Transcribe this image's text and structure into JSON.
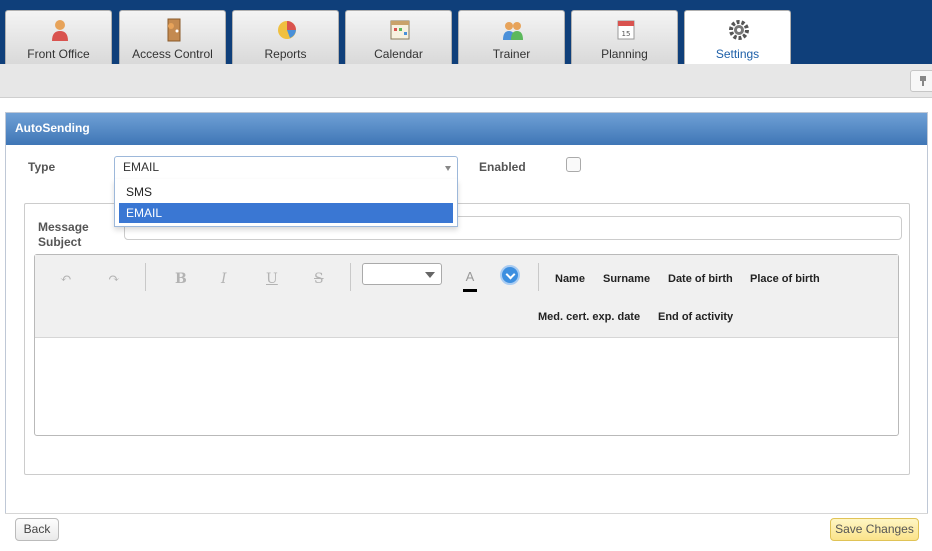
{
  "tabs": [
    {
      "label": "Front Office",
      "icon": "front-office-icon"
    },
    {
      "label": "Access Control",
      "icon": "access-control-icon"
    },
    {
      "label": "Reports",
      "icon": "reports-pie-icon"
    },
    {
      "label": "Calendar",
      "icon": "calendar-icon"
    },
    {
      "label": "Trainer",
      "icon": "trainer-icon"
    },
    {
      "label": "Planning",
      "icon": "planning-icon"
    },
    {
      "label": "Settings",
      "icon": "settings-gear-icon",
      "active": true
    }
  ],
  "panel": {
    "title": "AutoSending"
  },
  "form": {
    "type_label": "Type",
    "type_value": "EMAIL",
    "type_options": [
      "SMS",
      "EMAIL"
    ],
    "type_selected_option": "EMAIL",
    "enabled_label": "Enabled",
    "enabled_checked": false,
    "subject_label_line1": "Message",
    "subject_label_line2": "Subject",
    "subject_value": ""
  },
  "editor": {
    "toolbar": {
      "undo_icon": "undo-icon",
      "redo_icon": "redo-icon",
      "bold": "B",
      "italic": "I",
      "underline": "U",
      "strike": "S",
      "font_size_value": "",
      "text_color_glyph": "A",
      "text_color": "#000000"
    },
    "fields_row1": [
      "Name",
      "Surname",
      "Date of birth",
      "Place of birth"
    ],
    "fields_row2": [
      "Med. cert. exp. date",
      "End of activity"
    ],
    "content": ""
  },
  "footer": {
    "back_label": "Back",
    "save_label": "Save Changes"
  },
  "colors": {
    "topbar": "#0f3f7a",
    "panel_header": "#3f76b6",
    "selected_option": "#3a77d3",
    "save_button": "#fbe38a"
  }
}
